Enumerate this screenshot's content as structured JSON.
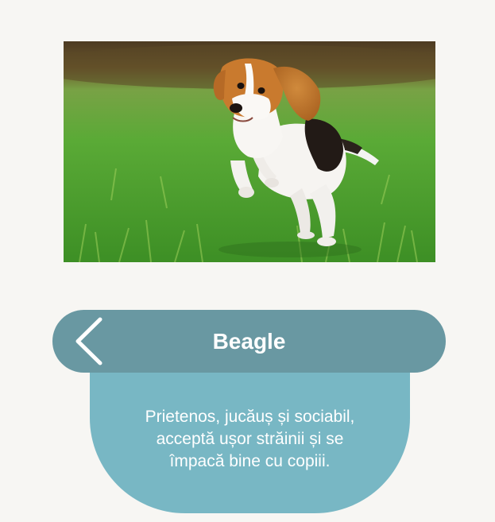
{
  "breed": {
    "name": "Beagle",
    "description": "Prietenos, jucăuș și sociabil,\nacceptă ușor străinii și se\nîmpacă bine cu copiii."
  },
  "icons": {
    "back": "chevron-left-icon"
  },
  "colors": {
    "background": "#f7f6f3",
    "header_bar": "#6998a2",
    "info_card": "#78b7c4",
    "text": "#ffffff"
  }
}
